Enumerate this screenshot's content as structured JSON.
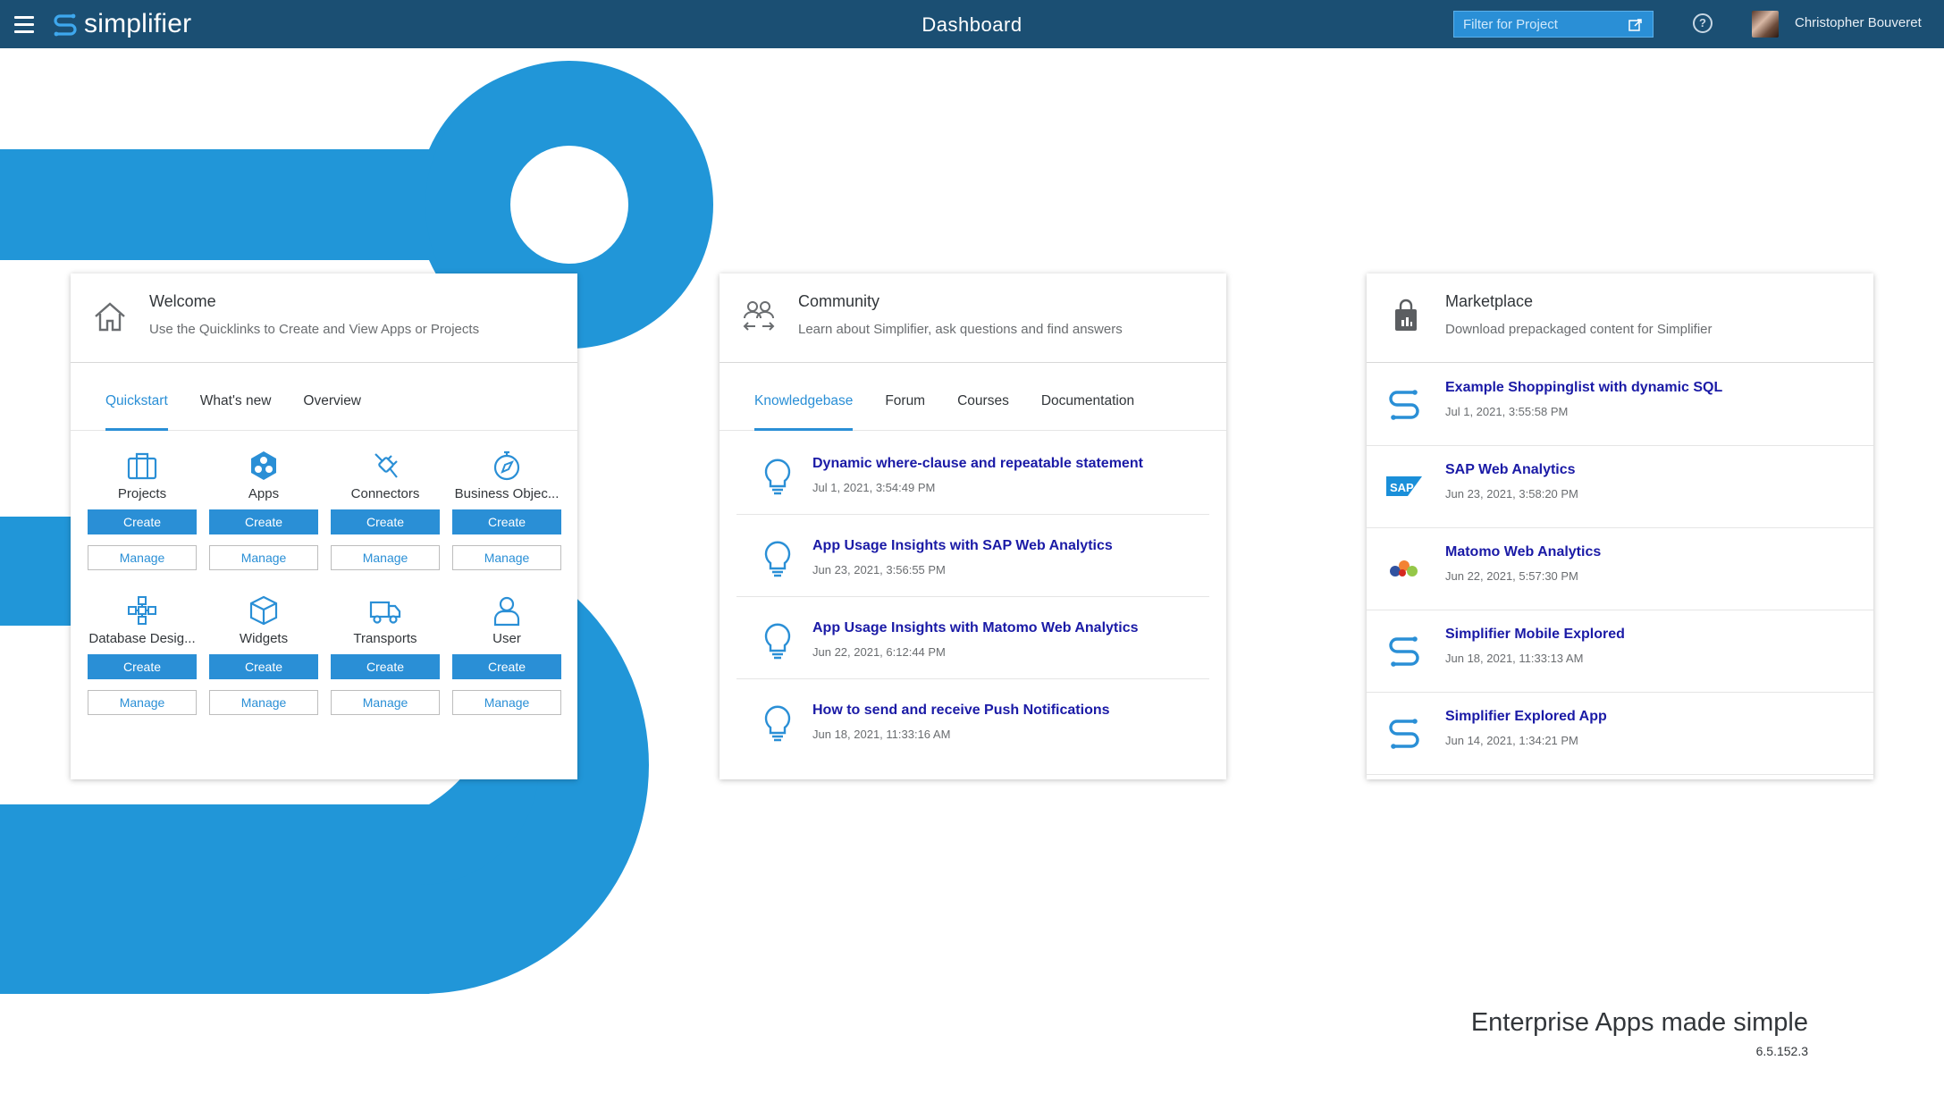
{
  "header": {
    "app_name": "simplifier",
    "title": "Dashboard",
    "filter_placeholder": "Filter for Project",
    "help_icon": "question-circle-icon",
    "user_name": "Christopher Bouveret"
  },
  "colors": {
    "brand_blue": "#2a8fd6",
    "header_bg": "#1b4f73",
    "link": "#1a1aa6"
  },
  "welcome": {
    "title": "Welcome",
    "subtitle": "Use the Quicklinks to Create and View Apps or Projects",
    "tabs": [
      "Quickstart",
      "What's new",
      "Overview"
    ],
    "active_tab": "Quickstart",
    "items": [
      {
        "label": "Projects",
        "icon": "briefcase-icon",
        "create": "Create",
        "manage": "Manage"
      },
      {
        "label": "Apps",
        "icon": "apps-hexagon-icon",
        "create": "Create",
        "manage": "Manage"
      },
      {
        "label": "Connectors",
        "icon": "connector-plug-icon",
        "create": "Create",
        "manage": "Manage"
      },
      {
        "label": "Business Objec...",
        "icon": "compass-icon",
        "create": "Create",
        "manage": "Manage"
      },
      {
        "label": "Database Desig...",
        "icon": "database-network-icon",
        "create": "Create",
        "manage": "Manage"
      },
      {
        "label": "Widgets",
        "icon": "cube-icon",
        "create": "Create",
        "manage": "Manage"
      },
      {
        "label": "Transports",
        "icon": "truck-icon",
        "create": "Create",
        "manage": "Manage"
      },
      {
        "label": "User",
        "icon": "user-icon",
        "create": "Create",
        "manage": "Manage"
      }
    ]
  },
  "community": {
    "title": "Community",
    "subtitle": "Learn about Simplifier, ask questions and find answers",
    "tabs": [
      "Knowledgebase",
      "Forum",
      "Courses",
      "Documentation"
    ],
    "active_tab": "Knowledgebase",
    "items": [
      {
        "title": "Dynamic where-clause and repeatable statement",
        "date": "Jul 1, 2021, 3:54:49 PM"
      },
      {
        "title": "App Usage Insights with SAP Web Analytics",
        "date": "Jun 23, 2021, 3:56:55 PM"
      },
      {
        "title": "App Usage Insights with Matomo Web Analytics",
        "date": "Jun 22, 2021, 6:12:44 PM"
      },
      {
        "title": "How to send and receive Push Notifications",
        "date": "Jun 18, 2021, 11:33:16 AM"
      }
    ]
  },
  "marketplace": {
    "title": "Marketplace",
    "subtitle": "Download prepackaged content for Simplifier",
    "items": [
      {
        "title": "Example Shoppinglist with dynamic SQL",
        "date": "Jul 1, 2021, 3:55:58 PM",
        "icon": "simplifier-logo-icon"
      },
      {
        "title": "SAP Web Analytics",
        "date": "Jun 23, 2021, 3:58:20 PM",
        "icon": "sap-logo-icon"
      },
      {
        "title": "Matomo Web Analytics",
        "date": "Jun 22, 2021, 5:57:30 PM",
        "icon": "matomo-logo-icon"
      },
      {
        "title": "Simplifier Mobile Explored",
        "date": "Jun 18, 2021, 11:33:13 AM",
        "icon": "simplifier-logo-icon"
      },
      {
        "title": "Simplifier Explored App",
        "date": "Jun 14, 2021, 1:34:21 PM",
        "icon": "simplifier-logo-icon"
      }
    ]
  },
  "footer": {
    "tagline": "Enterprise Apps made simple",
    "version": "6.5.152.3"
  }
}
